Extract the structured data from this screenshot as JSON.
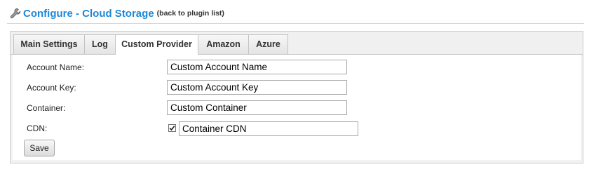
{
  "header": {
    "title": "Configure - Cloud Storage",
    "back_link": "(back to plugin list)",
    "icon": "wrench-icon"
  },
  "tabs": [
    {
      "label": "Main Settings",
      "active": false
    },
    {
      "label": "Log",
      "active": false
    },
    {
      "label": "Custom Provider",
      "active": true
    },
    {
      "label": "Amazon",
      "active": false
    },
    {
      "label": "Azure",
      "active": false
    }
  ],
  "form": {
    "account_name": {
      "label": "Account Name:",
      "value": "Custom Account Name"
    },
    "account_key": {
      "label": "Account Key:",
      "value": "Custom Account Key"
    },
    "container": {
      "label": "Container:",
      "value": "Custom Container"
    },
    "cdn": {
      "label": "CDN:",
      "checked": true,
      "value": "Container CDN"
    },
    "save_label": "Save"
  },
  "colors": {
    "title": "#1e88d8",
    "panel_bg": "#f2f2f2",
    "border": "#cccccc"
  }
}
